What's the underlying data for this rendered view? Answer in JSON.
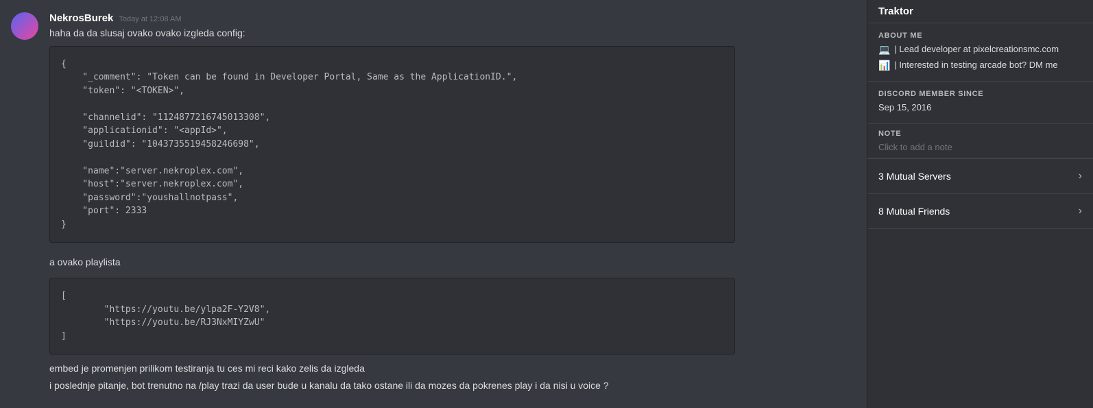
{
  "chat": {
    "message1": {
      "username": "NekrosBurek",
      "timestamp": "Today at 12:08 AM",
      "text_before": "haha da da slusaj ovako ovako izgleda config:",
      "code_block1": "{\n    \"_comment\": \"Token can be found in Developer Portal, Same as the ApplicationID.\",\n    \"token\": \"<TOKEN>\",\n\n    \"channelid\": \"1124877216745013308\",\n    \"applicationid\": \"<appId>\",\n    \"guildid\": \"1043735519458246698\",\n\n    \"name\":\"server.nekroplex.com\",\n    \"host\":\"server.nekroplex.com\",\n    \"password\":\"youshallnotpass\",\n    \"port\": 2333\n}",
      "text_middle": "a ovako playlista",
      "code_block2": "[\n        \"https://youtu.be/ylpa2F-Y2V8\",\n        \"https://youtu.be/RJ3NxMIYZwU\"\n]",
      "text_after1": "embed je promenjen prilikom testiranja tu ces mi reci kako zelis da izgleda",
      "text_after2": "i poslednje pitanje, bot trenutno na /play trazi da user bude u kanalu da tako ostane ili da mozes da pokrenes play i da nisi u voice ?"
    }
  },
  "right_panel": {
    "server_name": "Traktor",
    "about_me_label": "ABOUT ME",
    "about_me_items": [
      {
        "icon": "💻",
        "text": "| Lead developer at pixelcreationsmc.com"
      },
      {
        "icon": "📊",
        "text": "| Interested in testing arcade bot? DM me"
      }
    ],
    "discord_member_since_label": "DISCORD MEMBER SINCE",
    "discord_member_since": "Sep 15, 2016",
    "note_label": "NOTE",
    "note_placeholder": "Click to add a note",
    "mutual_servers_label": "3 Mutual Servers",
    "mutual_friends_label": "8 Mutual Friends"
  }
}
